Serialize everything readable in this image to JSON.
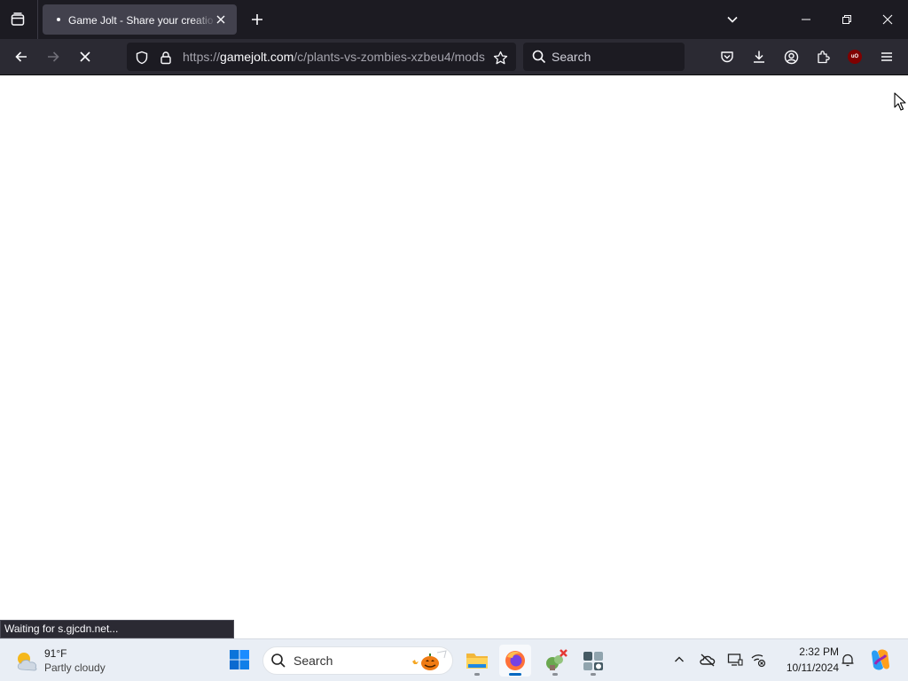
{
  "browser": {
    "tab": {
      "title": "Game Jolt - Share your creations"
    },
    "url": {
      "protocol": "https://",
      "domain": "gamejolt.com",
      "path": "/c/plants-vs-zombies-xzbeu4/mods"
    },
    "search": {
      "placeholder": "Search"
    },
    "status_text": "Waiting for s.gjcdn.net...",
    "icons": {
      "tab_list": "tab-list-icon",
      "close_tab": "close-icon",
      "new_tab": "plus-icon",
      "list_all_tabs": "chevron-down-icon",
      "back": "arrow-left-icon",
      "forward": "arrow-right-icon",
      "stop": "stop-x-icon",
      "tracking": "shield-icon",
      "lock": "lock-icon",
      "bookmark": "star-icon",
      "pocket": "pocket-icon",
      "downloads": "download-icon",
      "account": "account-icon",
      "extensions": "puzzle-icon",
      "ublock": "ublock-origin-icon",
      "menu": "hamburger-icon"
    },
    "colors": {
      "toolbar": "#2b2a33",
      "titlebar": "#1c1b22",
      "tab_active": "#42414d"
    }
  },
  "taskbar": {
    "weather": {
      "temp": "91°F",
      "condition": "Partly cloudy"
    },
    "search_placeholder": "Search",
    "clock": {
      "time": "2:32 PM",
      "date": "10/11/2024"
    },
    "apps": [
      "windows-start",
      "file-explorer",
      "firefox",
      "game-app",
      "system-app"
    ],
    "tray": [
      "chevron-up-icon",
      "onedrive-offline-icon",
      "display-icon",
      "wifi-disconnected-icon",
      "notification-bell-icon",
      "copilot-icon"
    ]
  }
}
